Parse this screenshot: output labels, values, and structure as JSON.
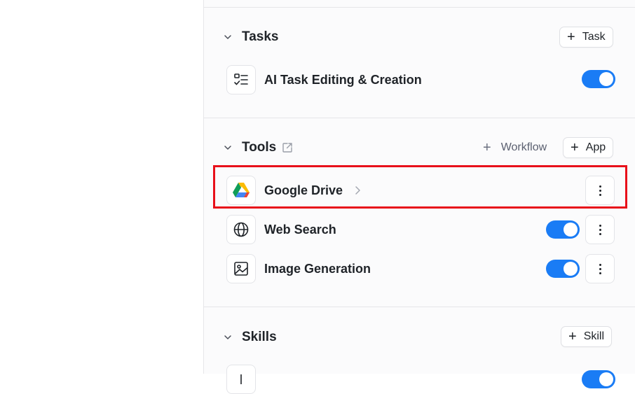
{
  "tasks": {
    "title": "Tasks",
    "add_label": "Task",
    "items": [
      {
        "label": "AI Task Editing & Creation",
        "icon": "task-list-icon",
        "enabled": true
      }
    ]
  },
  "tools": {
    "title": "Tools",
    "workflow_label": "Workflow",
    "app_label": "App",
    "items": [
      {
        "label": "Google Drive",
        "icon": "google-drive-icon"
      },
      {
        "label": "Web Search",
        "icon": "globe-icon",
        "enabled": true
      },
      {
        "label": "Image Generation",
        "icon": "image-icon",
        "enabled": true
      }
    ]
  },
  "skills": {
    "title": "Skills",
    "add_label": "Skill"
  },
  "colors": {
    "accent": "#1a7cf5",
    "highlight": "#e8101a"
  }
}
